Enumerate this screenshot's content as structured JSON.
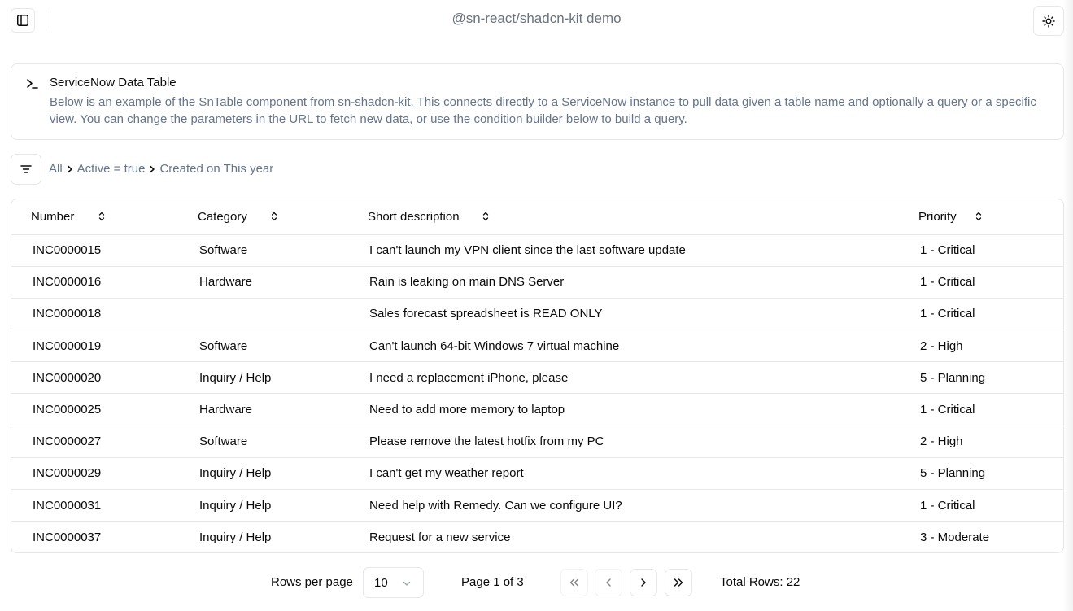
{
  "header": {
    "title": "@sn-react/shadcn-kit demo"
  },
  "info": {
    "title": "ServiceNow Data Table",
    "description": "Below is an example of the SnTable component from sn-shadcn-kit. This connects directly to a ServiceNow instance to pull data given a table name and optionally a query or a specific view. You can change the parameters in the URL to fetch new data, or use the condition builder below to build a query."
  },
  "filter": {
    "breadcrumbs": [
      "All",
      "Active = true",
      "Created on This year"
    ]
  },
  "table": {
    "columns": [
      "Number",
      "Category",
      "Short description",
      "Priority"
    ],
    "rows": [
      {
        "number": "INC0000015",
        "category": "Software",
        "short_description": "I can't launch my VPN client since the last software update",
        "priority": "1 - Critical"
      },
      {
        "number": "INC0000016",
        "category": "Hardware",
        "short_description": "Rain is leaking on main DNS Server",
        "priority": "1 - Critical"
      },
      {
        "number": "INC0000018",
        "category": "",
        "short_description": "Sales forecast spreadsheet is READ ONLY",
        "priority": "1 - Critical"
      },
      {
        "number": "INC0000019",
        "category": "Software",
        "short_description": "Can't launch 64-bit Windows 7 virtual machine",
        "priority": "2 - High"
      },
      {
        "number": "INC0000020",
        "category": "Inquiry / Help",
        "short_description": "I need a replacement iPhone, please",
        "priority": "5 - Planning"
      },
      {
        "number": "INC0000025",
        "category": "Hardware",
        "short_description": "Need to add more memory to laptop",
        "priority": "1 - Critical"
      },
      {
        "number": "INC0000027",
        "category": "Software",
        "short_description": "Please remove the latest hotfix from my PC",
        "priority": "2 - High"
      },
      {
        "number": "INC0000029",
        "category": "Inquiry / Help",
        "short_description": "I can't get my weather report",
        "priority": "5 - Planning"
      },
      {
        "number": "INC0000031",
        "category": "Inquiry / Help",
        "short_description": "Need help with Remedy. Can we configure UI?",
        "priority": "1 - Critical"
      },
      {
        "number": "INC0000037",
        "category": "Inquiry / Help",
        "short_description": "Request for a new service",
        "priority": "3 - Moderate"
      }
    ]
  },
  "pagination": {
    "rows_per_page_label": "Rows per page",
    "rows_per_page_value": "10",
    "page_info": "Page 1 of 3",
    "total_rows": "Total Rows: 22"
  },
  "icons": {
    "sidebar_toggle": "panel-left-icon",
    "theme_toggle": "sun-icon",
    "terminal": "terminal-icon",
    "filter": "filter-lines-icon",
    "sort": "chevrons-up-down-icon",
    "first_page": "chevrons-left-icon",
    "prev_page": "chevron-left-icon",
    "next_page": "chevron-right-icon",
    "last_page": "chevrons-right-icon"
  },
  "colors": {
    "border": "#e5e7eb",
    "muted_text": "#64748b",
    "title_text": "#6b7280",
    "text": "#0a0a0a"
  }
}
